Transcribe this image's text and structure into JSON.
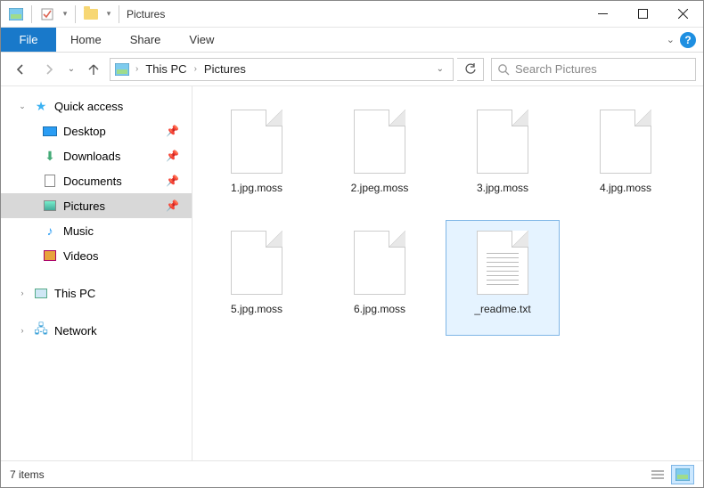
{
  "window": {
    "title": "Pictures"
  },
  "ribbon": {
    "file": "File",
    "tabs": [
      "Home",
      "Share",
      "View"
    ]
  },
  "breadcrumb": {
    "parts": [
      "This PC",
      "Pictures"
    ]
  },
  "search": {
    "placeholder": "Search Pictures"
  },
  "sidebar": {
    "quick_access": {
      "label": "Quick access"
    },
    "items": [
      {
        "label": "Desktop",
        "icon": "desktop",
        "pinned": true
      },
      {
        "label": "Downloads",
        "icon": "download",
        "pinned": true
      },
      {
        "label": "Documents",
        "icon": "doc",
        "pinned": true
      },
      {
        "label": "Pictures",
        "icon": "pic",
        "pinned": true,
        "selected": true
      },
      {
        "label": "Music",
        "icon": "music",
        "pinned": false
      },
      {
        "label": "Videos",
        "icon": "video",
        "pinned": false
      }
    ],
    "this_pc": {
      "label": "This PC"
    },
    "network": {
      "label": "Network"
    }
  },
  "files": [
    {
      "name": "1.jpg.moss",
      "type": "blank",
      "selected": false
    },
    {
      "name": "2.jpeg.moss",
      "type": "blank",
      "selected": false
    },
    {
      "name": "3.jpg.moss",
      "type": "blank",
      "selected": false
    },
    {
      "name": "4.jpg.moss",
      "type": "blank",
      "selected": false
    },
    {
      "name": "5.jpg.moss",
      "type": "blank",
      "selected": false
    },
    {
      "name": "6.jpg.moss",
      "type": "blank",
      "selected": false
    },
    {
      "name": "_readme.txt",
      "type": "txt",
      "selected": true
    }
  ],
  "status": {
    "text": "7 items"
  }
}
